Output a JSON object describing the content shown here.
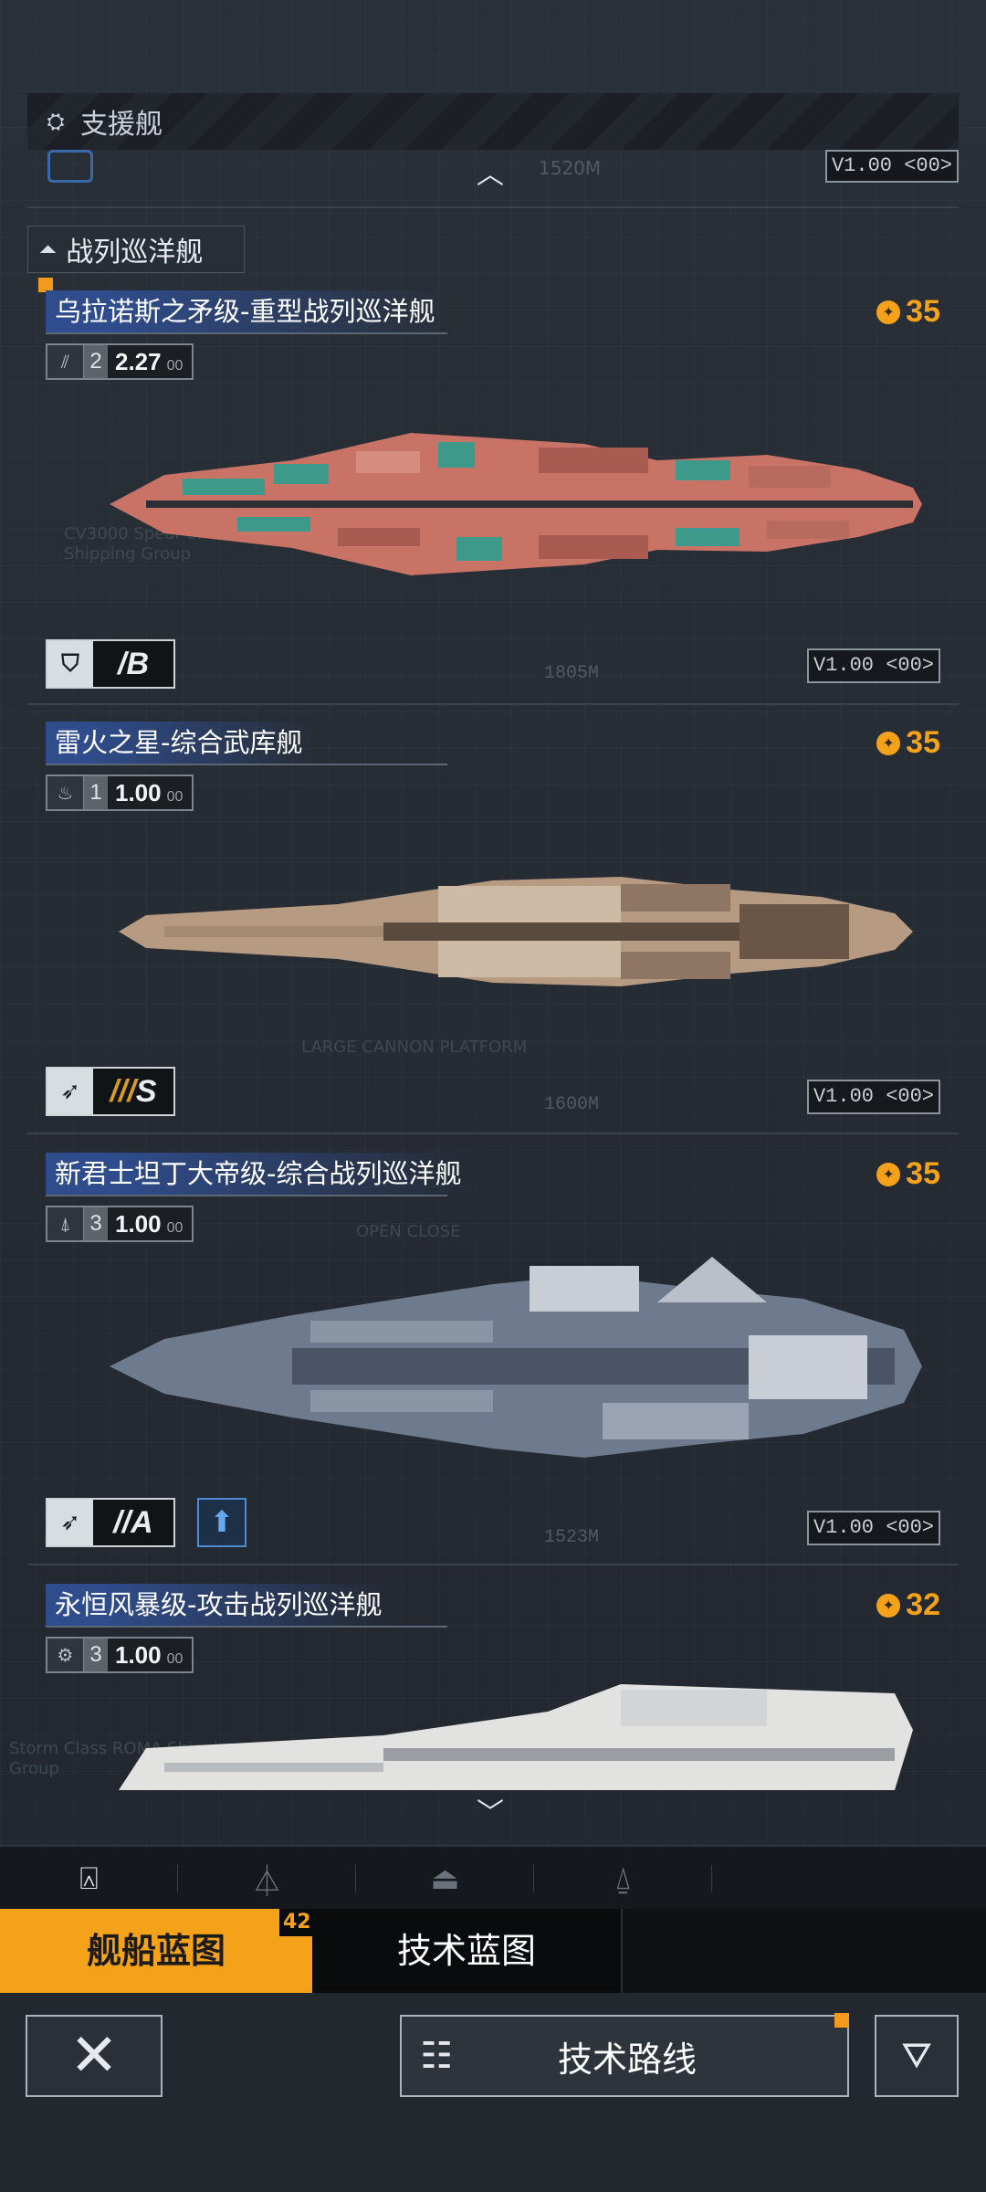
{
  "support_section": {
    "label": "支援舰",
    "collapsed_length": "1520M",
    "collapsed_version": "V1.00 <00>"
  },
  "category": {
    "label": "战列巡洋舰"
  },
  "ships": [
    {
      "name": "乌拉诺斯之矛级-重型战列巡洋舰",
      "cost": "35",
      "level": "2",
      "value": "2.27",
      "value_decimal": "00",
      "grade": "/B",
      "length": "1805M",
      "version": "V1.00 <00>",
      "blueprint_text": "CV3000 Spear of Uranus Class ROMA Shipping Group",
      "colors": {
        "hull": "#c97266",
        "accent": "#3d9a8a"
      }
    },
    {
      "name": "雷火之星-综合武库舰",
      "cost": "35",
      "level": "1",
      "value": "1.00",
      "value_decimal": "00",
      "grade": "S",
      "grade_prefix": "///",
      "length": "1600M",
      "version": "V1.00 <00>",
      "blueprint_text": "LARGE CANNON PLATFORM",
      "colors": {
        "hull": "#b79a82",
        "accent": "#5a4a3e"
      }
    },
    {
      "name": "新君士坦丁大帝级-综合战列巡洋舰",
      "cost": "35",
      "level": "3",
      "value": "1.00",
      "value_decimal": "00",
      "grade": "//A",
      "length": "1523M",
      "version": "V1.00 <00>",
      "blueprint_text": "OPEN   CLOSE",
      "colors": {
        "hull": "#6e7a8e",
        "accent": "#c9ced6"
      }
    },
    {
      "name": "永恒风暴级-攻击战列巡洋舰",
      "cost": "32",
      "level": "3",
      "value": "1.00",
      "value_decimal": "00",
      "blueprint_text": "Storm Class ROMA Shipping Group",
      "colors": {
        "hull": "#e2e2e0",
        "accent": "#9a9ea2"
      }
    }
  ],
  "modes": {
    "ship_blueprint": "舰船蓝图",
    "ship_blueprint_count": "42",
    "tech_blueprint": "技术蓝图"
  },
  "actions": {
    "tech_route": "技术路线"
  },
  "icons": {
    "close": "close-icon",
    "filter": "filter-icon",
    "tech_tree": "tech-tree-icon",
    "coin": "coin-icon"
  },
  "colors": {
    "accent": "#f3a21a",
    "title_blue": "#2f4c8c",
    "upgrade_blue": "#4f8bd0"
  }
}
